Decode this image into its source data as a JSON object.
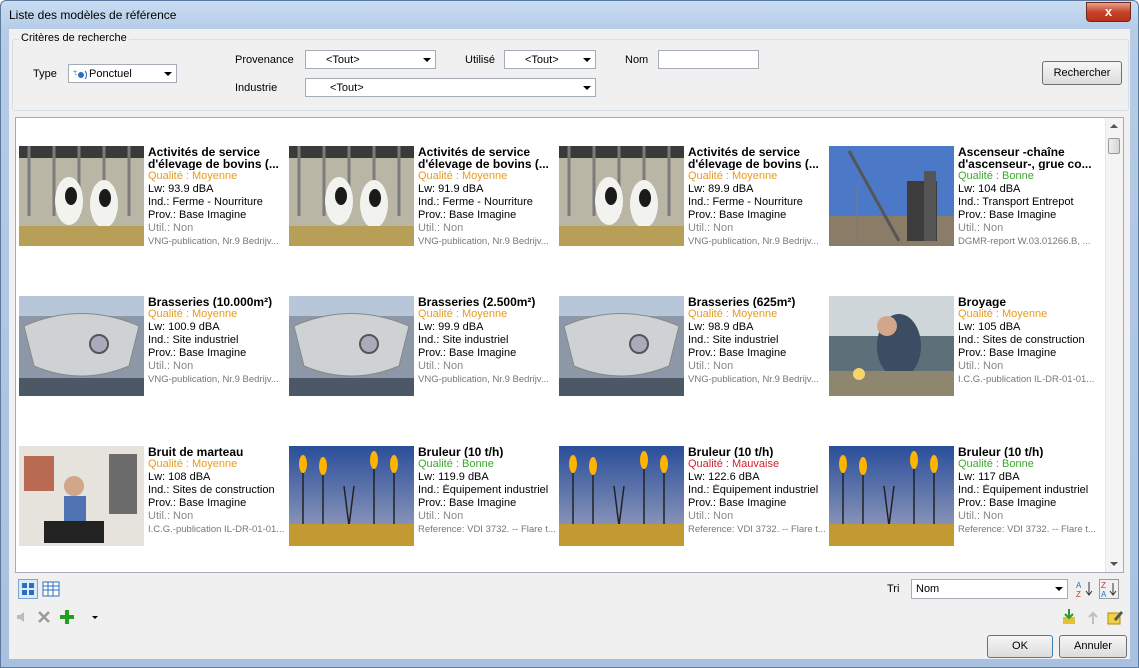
{
  "window": {
    "title": "Liste des modèles de référence",
    "close_label": "x"
  },
  "search": {
    "legend": "Critères de recherche",
    "type_label": "Type",
    "type_value": "Ponctuel",
    "provenance_label": "Provenance",
    "provenance_value": "<Tout>",
    "utilise_label": "Utilisé",
    "utilise_value": "<Tout>",
    "nom_label": "Nom",
    "nom_value": "",
    "industrie_label": "Industrie",
    "industrie_value": "<Tout>",
    "search_button": "Rechercher"
  },
  "items": [
    {
      "name": "Activités de service d'élevage de bovins (...",
      "quality": "Qualité : Moyenne",
      "q": "moy",
      "lw": "Lw: 93.9 dBA",
      "ind": "Ind.: Ferme - Nourriture",
      "prov": "Prov.: Base Imagine",
      "util": "Util.: Non",
      "ref": "VNG-publication, Nr.9 Bedrijv...",
      "img": "cows"
    },
    {
      "name": "Activités de service d'élevage de bovins (...",
      "quality": "Qualité : Moyenne",
      "q": "moy",
      "lw": "Lw: 91.9 dBA",
      "ind": "Ind.: Ferme - Nourriture",
      "prov": "Prov.: Base Imagine",
      "util": "Util.: Non",
      "ref": "VNG-publication, Nr.9 Bedrijv...",
      "img": "cows"
    },
    {
      "name": "Activités de service d'élevage de bovins (...",
      "quality": "Qualité : Moyenne",
      "q": "moy",
      "lw": "Lw: 89.9 dBA",
      "ind": "Ind.: Ferme - Nourriture",
      "prov": "Prov.: Base Imagine",
      "util": "Util.: Non",
      "ref": "VNG-publication, Nr.9 Bedrijv...",
      "img": "cows"
    },
    {
      "name": "Ascenseur -chaîne d'ascenseur-, grue co...",
      "quality": "Qualité : Bonne",
      "q": "bon",
      "lw": "Lw: 104 dBA",
      "ind": "Ind.: Transport Entrepot",
      "prov": "Prov.: Base Imagine",
      "util": "Util.: Non",
      "ref": "DGMR-report W.03.01266.B, ...",
      "img": "crane"
    },
    {
      "name": "Brasseries (10.000m²)",
      "quality": "Qualité : Moyenne",
      "q": "moy",
      "lw": "Lw: 100.9 dBA",
      "ind": "Ind.: Site industriel",
      "prov": "Prov.: Base Imagine",
      "util": "Util.: Non",
      "ref": "VNG-publication, Nr.9 Bedrijv...",
      "img": "tank"
    },
    {
      "name": "Brasseries (2.500m²)",
      "quality": "Qualité : Moyenne",
      "q": "moy",
      "lw": "Lw: 99.9 dBA",
      "ind": "Ind.: Site industriel",
      "prov": "Prov.: Base Imagine",
      "util": "Util.: Non",
      "ref": "VNG-publication, Nr.9 Bedrijv...",
      "img": "tank"
    },
    {
      "name": "Brasseries (625m²)",
      "quality": "Qualité : Moyenne",
      "q": "moy",
      "lw": "Lw: 98.9 dBA",
      "ind": "Ind.: Site industriel",
      "prov": "Prov.: Base Imagine",
      "util": "Util.: Non",
      "ref": "VNG-publication, Nr.9 Bedrijv...",
      "img": "tank"
    },
    {
      "name": "Broyage",
      "quality": "Qualité : Moyenne",
      "q": "moy",
      "lw": "Lw: 105 dBA",
      "ind": "Ind.: Sites de construction",
      "prov": "Prov.: Base Imagine",
      "util": "Util.: Non",
      "ref": "I.C.G.-publication IL-DR-01-01...",
      "img": "grind"
    },
    {
      "name": "Bruit de marteau",
      "quality": "Qualité : Moyenne",
      "q": "moy",
      "lw": "Lw: 108 dBA",
      "ind": "Ind.: Sites de construction",
      "prov": "Prov.: Base Imagine",
      "util": "Util.: Non",
      "ref": "I.C.G.-publication IL-DR-01-01...",
      "img": "hammer"
    },
    {
      "name": "Bruleur (10 t/h)",
      "quality": "Qualité : Bonne",
      "q": "bon",
      "lw": "Lw: 119.9 dBA",
      "ind": "Ind.: Équipement industriel",
      "prov": "Prov.: Base Imagine",
      "util": "Util.: Non",
      "ref": "Reference: VDI 3732. -- Flare t...",
      "img": "flare"
    },
    {
      "name": "Bruleur (10 t/h)",
      "quality": "Qualité : Mauvaise",
      "q": "mau",
      "lw": "Lw: 122.6 dBA",
      "ind": "Ind.: Équipement industriel",
      "prov": "Prov.: Base Imagine",
      "util": "Util.: Non",
      "ref": "Reference: VDI 3732. -- Flare t...",
      "img": "flare"
    },
    {
      "name": "Bruleur (10 t/h)",
      "quality": "Qualité : Bonne",
      "q": "bon",
      "lw": "Lw: 117 dBA",
      "ind": "Ind.: Équipement industriel",
      "prov": "Prov.: Base Imagine",
      "util": "Util.: Non",
      "ref": "Reference: VDI 3732. -- Flare t...",
      "img": "flare"
    }
  ],
  "sort": {
    "label": "Tri",
    "value": "Nom"
  },
  "footer": {
    "ok": "OK",
    "cancel": "Annuler"
  }
}
